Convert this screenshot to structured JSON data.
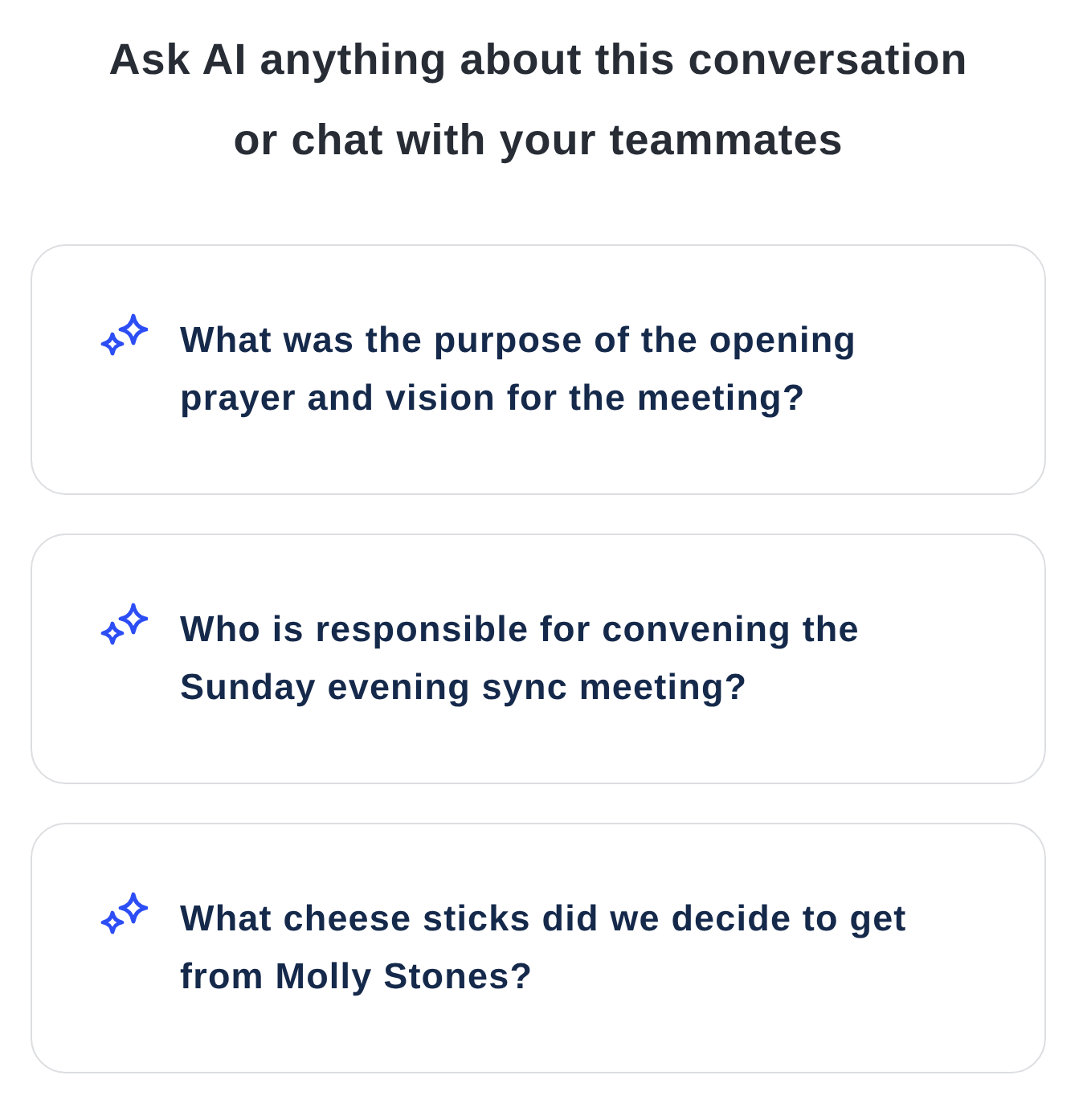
{
  "heading": {
    "lines": [
      "Ask AI anything about this conversation",
      "or chat with your teammates"
    ]
  },
  "suggestions": [
    {
      "text": "What was the purpose of the opening prayer and vision for the meeting?"
    },
    {
      "text": "Who is responsible for convening the Sunday evening sync meeting?"
    },
    {
      "text": "What cheese sticks did we decide to get from Molly Stones?"
    }
  ]
}
